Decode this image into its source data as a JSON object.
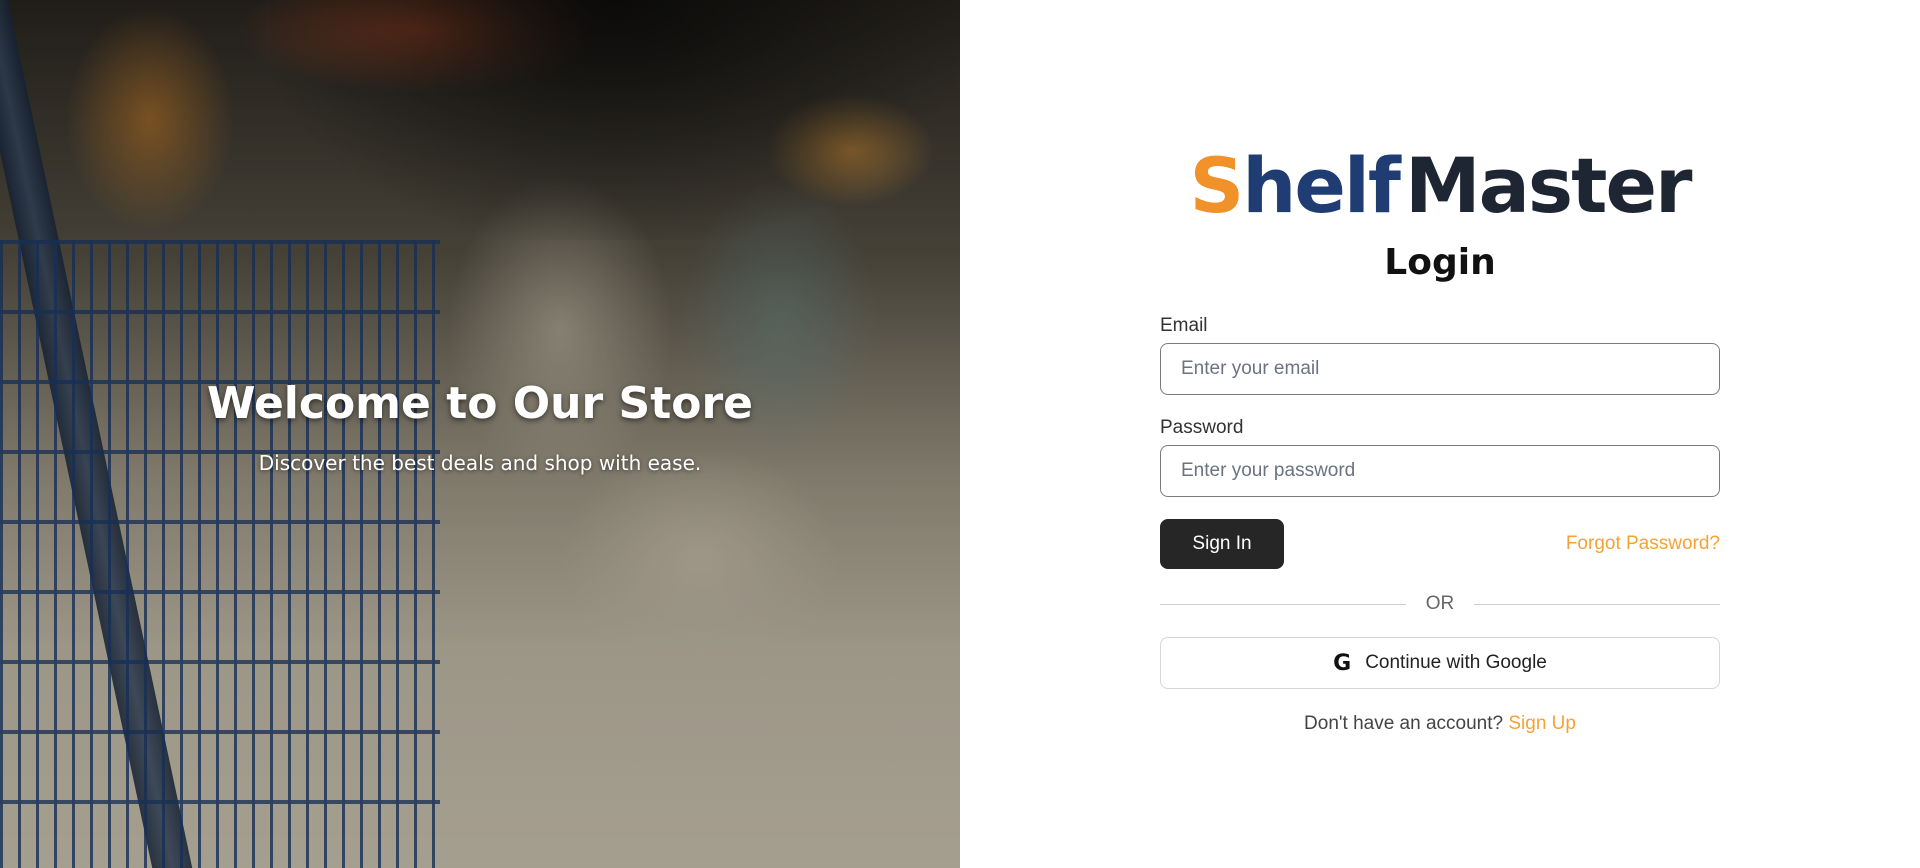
{
  "hero": {
    "title": "Welcome to Our Store",
    "subtitle": "Discover the best deals and shop with ease."
  },
  "brand": {
    "logo_part1": "S",
    "logo_part2": "helf",
    "logo_part3": "Master",
    "colors": {
      "accent_orange": "#f0912a",
      "navy": "#1f3d73",
      "dark": "#1e2633"
    }
  },
  "login": {
    "title": "Login",
    "email_label": "Email",
    "email_placeholder": "Enter your email",
    "password_label": "Password",
    "password_placeholder": "Enter your password",
    "signin_label": "Sign In",
    "forgot_label": "Forgot Password?",
    "or_label": "OR",
    "google_icon": "google-icon",
    "google_label": "Continue with Google",
    "signup_prompt": "Don't have an account?",
    "signup_label": "Sign Up",
    "colors": {
      "button_bg": "#262626",
      "link": "#f5a234"
    }
  }
}
